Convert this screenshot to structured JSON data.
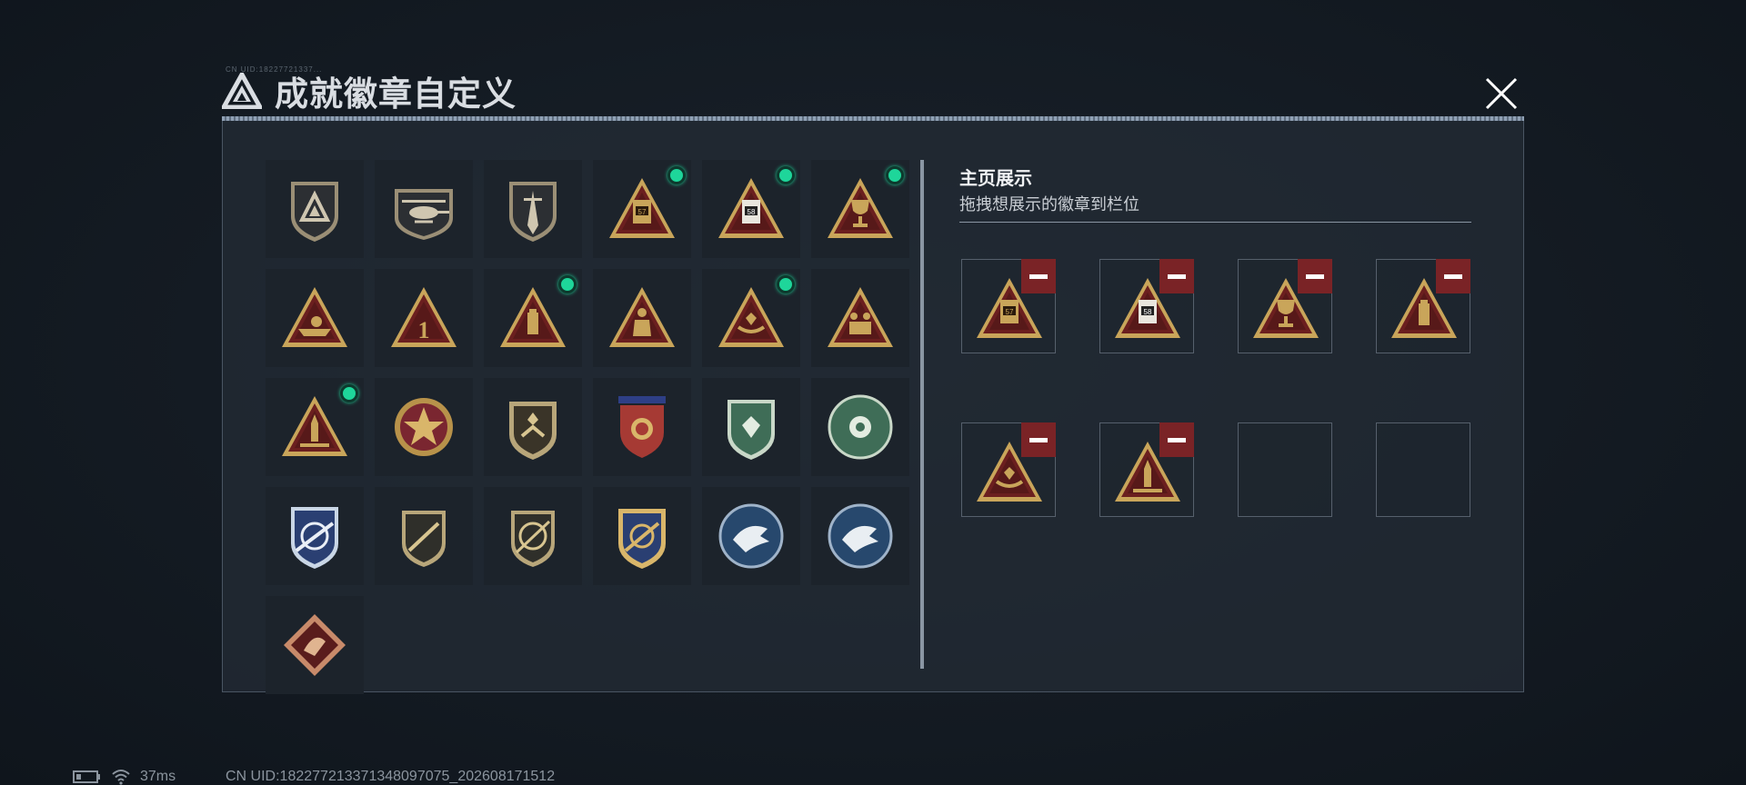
{
  "header": {
    "title": "成就徽章自定义",
    "subtitle": "CN UID:18227721337...",
    "close_icon": "close-icon"
  },
  "badge_grid": {
    "badges": [
      {
        "icon": "triangle-logo-shield-badge",
        "new": false
      },
      {
        "icon": "helicopter-shield-badge",
        "new": false
      },
      {
        "icon": "dagger-shield-badge",
        "new": false
      },
      {
        "icon": "ammo-57-triangle-badge",
        "new": true
      },
      {
        "icon": "ammo-58-triangle-badge",
        "new": true
      },
      {
        "icon": "trophy-triangle-badge",
        "new": true
      },
      {
        "icon": "boat-triangle-badge",
        "new": false
      },
      {
        "icon": "number-one-triangle-badge",
        "new": false
      },
      {
        "icon": "usb-drive-triangle-badge",
        "new": true
      },
      {
        "icon": "soldier-triangle-badge",
        "new": false
      },
      {
        "icon": "hands-gem-triangle-badge",
        "new": true
      },
      {
        "icon": "squad-triangle-badge",
        "new": false
      },
      {
        "icon": "rocket-triangle-badge",
        "new": true
      },
      {
        "icon": "star-medal-badge",
        "new": false
      },
      {
        "icon": "chevron-shield-badge",
        "new": false
      },
      {
        "icon": "stars-wreath-shield-badge",
        "new": false
      },
      {
        "icon": "green-gem-shield-badge",
        "new": false
      },
      {
        "icon": "green-flower-badge",
        "new": false
      },
      {
        "icon": "blue-crosshair-rifle-badge",
        "new": false
      },
      {
        "icon": "rifle-shield-badge",
        "new": false
      },
      {
        "icon": "sniper-shield-badge",
        "new": false
      },
      {
        "icon": "gold-crosshair-shield-badge",
        "new": false
      },
      {
        "icon": "eagle-round-badge",
        "new": false
      },
      {
        "icon": "eagle-round-badge-2",
        "new": false
      },
      {
        "icon": "dragon-diamond-badge",
        "new": false
      }
    ]
  },
  "showcase": {
    "title": "主页展示",
    "subtitle": "拖拽想展示的徽章到栏位",
    "slots": [
      {
        "icon": "ammo-57-triangle-badge",
        "filled": true
      },
      {
        "icon": "ammo-58-triangle-badge",
        "filled": true
      },
      {
        "icon": "trophy-triangle-badge",
        "filled": true
      },
      {
        "icon": "usb-drive-triangle-badge",
        "filled": true
      },
      {
        "icon": "hands-gem-triangle-badge",
        "filled": true
      },
      {
        "icon": "rocket-triangle-badge",
        "filled": true
      },
      {
        "icon": "",
        "filled": false
      },
      {
        "icon": "",
        "filled": false
      }
    ]
  },
  "status_bar": {
    "battery_icon": "battery-icon",
    "wifi_icon": "wifi-icon",
    "ping": "37ms",
    "uid": "CN UID:182277213371348097075_202608171512"
  },
  "colors": {
    "accent_new": "#1ed69a",
    "remove_red": "#7a2326",
    "gold": "#c9a55a",
    "triangle_red": "#6b1f1f"
  }
}
